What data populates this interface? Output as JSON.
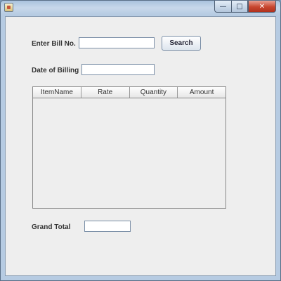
{
  "window": {
    "controls": {
      "minimize": "—",
      "maximize": "□",
      "close": "✕"
    }
  },
  "form": {
    "bill_no_label": "Enter Bill No.",
    "bill_no_value": "",
    "search_button": "Search",
    "date_label": "Date of Billing",
    "date_value": "",
    "grand_total_label": "Grand Total",
    "grand_total_value": ""
  },
  "table": {
    "columns": [
      "ItemName",
      "Rate",
      "Quantity",
      "Amount"
    ],
    "rows": []
  }
}
